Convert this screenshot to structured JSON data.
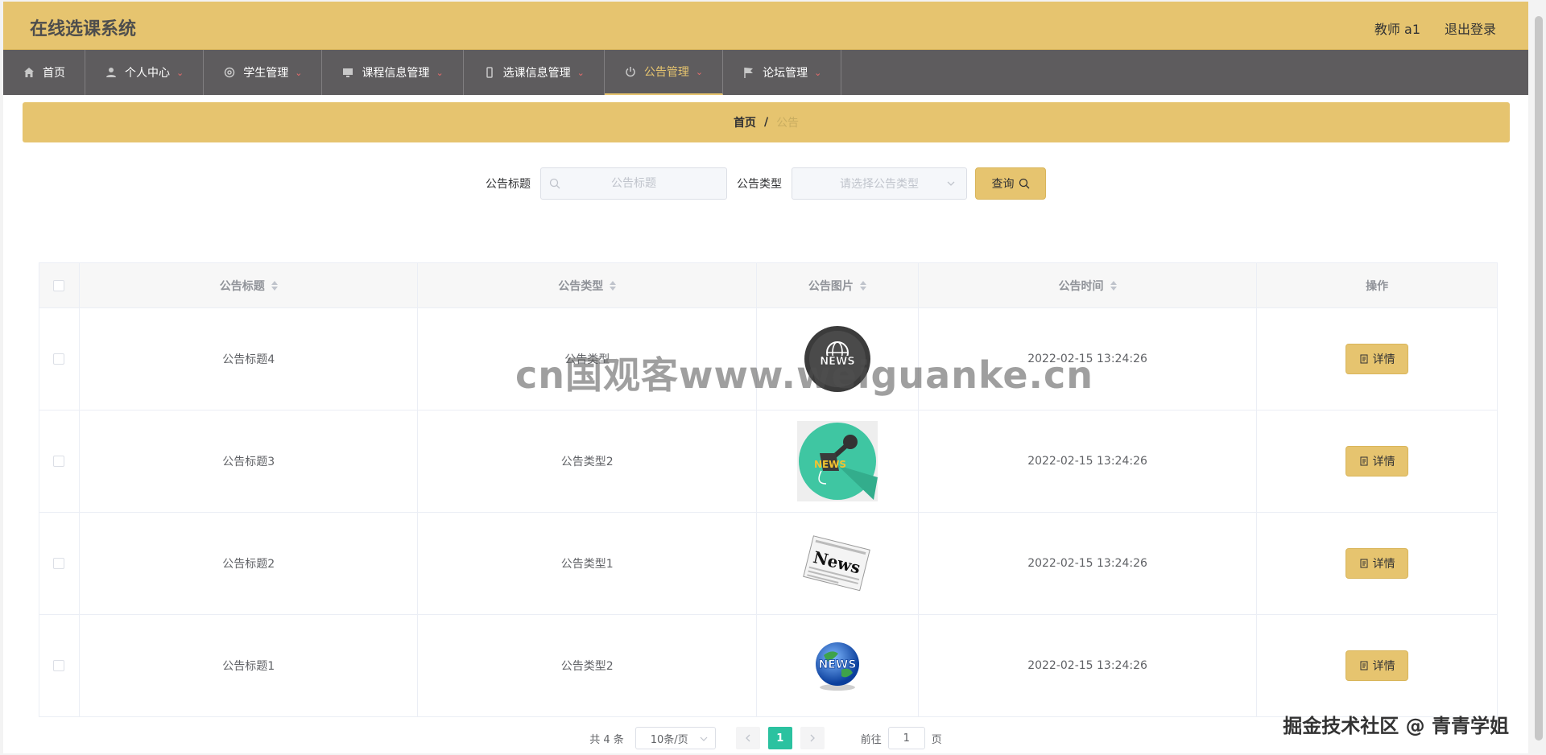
{
  "header": {
    "app_title": "在线选课系统",
    "user": "教师 a1",
    "logout": "退出登录"
  },
  "nav": {
    "items": [
      {
        "label": "首页",
        "icon": "home-icon"
      },
      {
        "label": "个人中心",
        "icon": "user-icon"
      },
      {
        "label": "学生管理",
        "icon": "gear-icon"
      },
      {
        "label": "课程信息管理",
        "icon": "monitor-icon"
      },
      {
        "label": "选课信息管理",
        "icon": "phone-icon"
      },
      {
        "label": "公告管理",
        "icon": "power-icon"
      },
      {
        "label": "论坛管理",
        "icon": "flag-icon"
      }
    ],
    "active_index": 5
  },
  "breadcrumb": {
    "home": "首页",
    "separator": "/",
    "current": "公告"
  },
  "search": {
    "title_label": "公告标题",
    "title_placeholder": "公告标题",
    "type_label": "公告类型",
    "type_placeholder": "请选择公告类型",
    "query_button": "查询"
  },
  "table": {
    "headers": [
      "公告标题",
      "公告类型",
      "公告图片",
      "公告时间",
      "操作"
    ],
    "rows": [
      {
        "title": "公告标题4",
        "type": "公告类型",
        "image": "news-globe-dark-icon",
        "time": "2022-02-15 13:24:26",
        "action": "详情"
      },
      {
        "title": "公告标题3",
        "type": "公告类型2",
        "image": "news-microphone-icon",
        "time": "2022-02-15 13:24:26",
        "action": "详情"
      },
      {
        "title": "公告标题2",
        "type": "公告类型1",
        "image": "newspaper-icon",
        "time": "2022-02-15 13:24:26",
        "action": "详情"
      },
      {
        "title": "公告标题1",
        "type": "公告类型2",
        "image": "news-blue-globe-icon",
        "time": "2022-02-15 13:24:26",
        "action": "详情"
      }
    ]
  },
  "pagination": {
    "total": "共 4 条",
    "page_size": "10条/页",
    "current_page": "1",
    "goto_label": "前往",
    "goto_value": "1",
    "page_unit": "页"
  },
  "watermarks": {
    "center": "cn国观客www.weiguanke.cn",
    "corner": "掘金技术社区 @ 青青学姐"
  },
  "colors": {
    "accent": "#e6c46f",
    "nav_bg": "#5e5c5e",
    "pager_active": "#2bc2a0"
  }
}
